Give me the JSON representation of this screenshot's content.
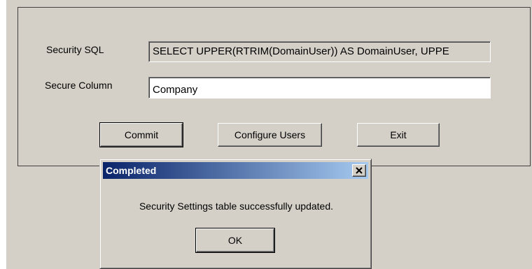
{
  "form": {
    "security_sql_label": "Security SQL",
    "security_sql_value": "SELECT UPPER(RTRIM(DomainUser)) AS DomainUser, UPPE",
    "secure_column_label": "Secure Column",
    "secure_column_value": "Company"
  },
  "buttons": {
    "commit": "Commit",
    "configure_users": "Configure Users",
    "exit": "Exit"
  },
  "dialog": {
    "title": "Completed",
    "message": "Security Settings table successfully updated.",
    "ok_label": "OK",
    "close_icon": "close-icon"
  },
  "colors": {
    "window_face": "#d4d0c8",
    "titlebar_start": "#0a246a",
    "titlebar_end": "#a6caf0"
  }
}
